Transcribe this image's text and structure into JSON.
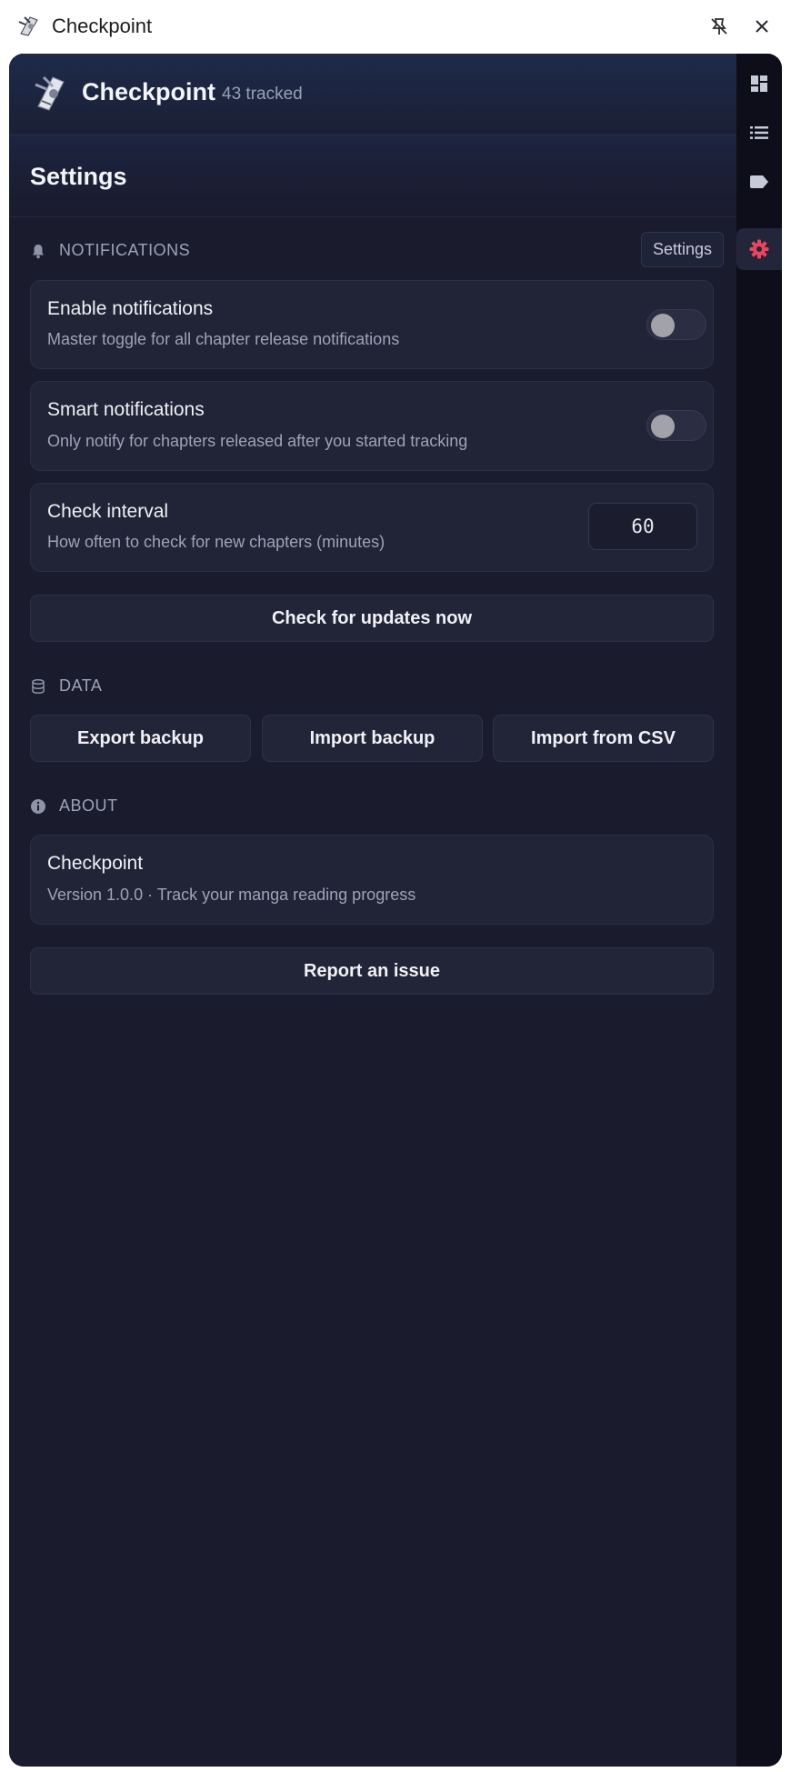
{
  "window": {
    "title": "Checkpoint",
    "pin_icon": "pin-off-icon",
    "close_icon": "close-icon"
  },
  "header": {
    "brand": "Checkpoint",
    "tracked": "43 tracked"
  },
  "page": {
    "title": "Settings"
  },
  "tooltip": {
    "text": "Settings"
  },
  "notifications": {
    "heading": "NOTIFICATIONS",
    "enable": {
      "title": "Enable notifications",
      "desc": "Master toggle for all chapter release notifications",
      "on": false
    },
    "smart": {
      "title": "Smart notifications",
      "desc": "Only notify for chapters released after you started tracking",
      "on": false
    },
    "interval": {
      "title": "Check interval",
      "desc": "How often to check for new chapters (minutes)",
      "value": "60"
    },
    "check_now": "Check for updates now"
  },
  "data_section": {
    "heading": "DATA",
    "export": "Export backup",
    "import": "Import backup",
    "import_csv": "Import from CSV"
  },
  "about": {
    "heading": "ABOUT",
    "app_name": "Checkpoint",
    "version_line": "Version 1.0.0 · Track your manga reading progress",
    "report": "Report an issue"
  },
  "rail": {
    "items": [
      {
        "icon": "dashboard-icon",
        "active": false
      },
      {
        "icon": "list-icon",
        "active": false
      },
      {
        "icon": "tag-icon",
        "active": false
      },
      {
        "icon": "gear-icon",
        "active": true
      }
    ]
  },
  "colors": {
    "accent": "#e8455f",
    "panel_bg": "#1a1b2d",
    "card_bg": "#212336",
    "rail_bg": "#0e0e1a"
  }
}
